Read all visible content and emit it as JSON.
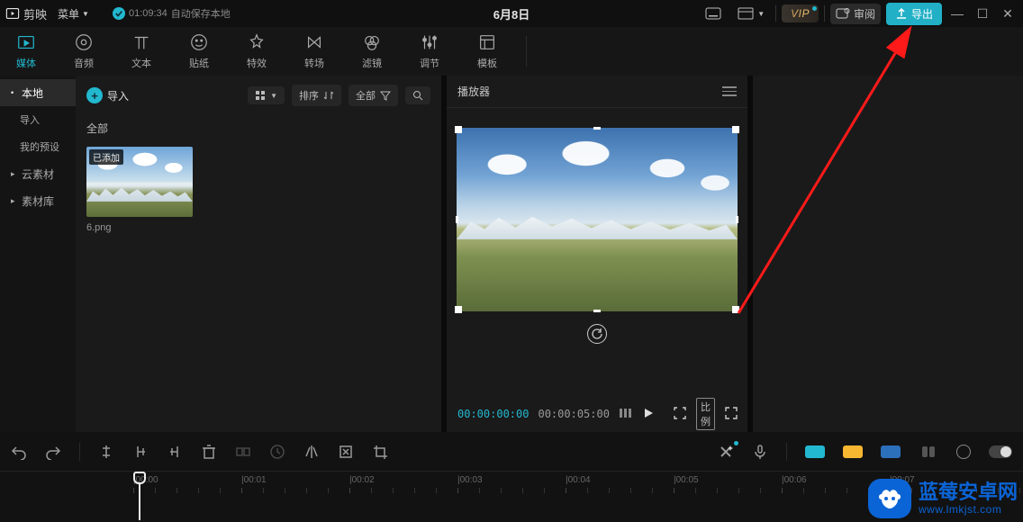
{
  "titlebar": {
    "appName": "剪映",
    "menu": "菜单",
    "saveTime": "01:09:34",
    "saveText": "自动保存本地",
    "projectTitle": "6月8日",
    "review": "审阅",
    "export": "导出"
  },
  "toolTabs": [
    {
      "id": "media",
      "label": "媒体"
    },
    {
      "id": "audio",
      "label": "音频"
    },
    {
      "id": "text",
      "label": "文本"
    },
    {
      "id": "sticker",
      "label": "贴纸"
    },
    {
      "id": "effect",
      "label": "特效"
    },
    {
      "id": "transition",
      "label": "转场"
    },
    {
      "id": "filter",
      "label": "滤镜"
    },
    {
      "id": "adjust",
      "label": "调节"
    },
    {
      "id": "template",
      "label": "模板"
    }
  ],
  "sideNav": {
    "local": "本地",
    "import": "导入",
    "myPreset": "我的预设",
    "cloud": "云素材",
    "library": "素材库"
  },
  "mediaPanel": {
    "importBtn": "导入",
    "sort": "排序",
    "filterAll": "全部",
    "sectionAll": "全部",
    "thumbBadge": "已添加",
    "thumbName": "6.png"
  },
  "player": {
    "title": "播放器",
    "current": "00:00:00:00",
    "duration": "00:00:05:00",
    "ratio": "比例"
  },
  "timeline": {
    "ticks": [
      "|00:00",
      "|00:01",
      "|00:02",
      "|00:03",
      "|00:04",
      "|00:05",
      "|00:06",
      "|00:07"
    ]
  },
  "watermark": {
    "main": "蓝莓安卓网",
    "sub": "www.lmkjst.com"
  }
}
